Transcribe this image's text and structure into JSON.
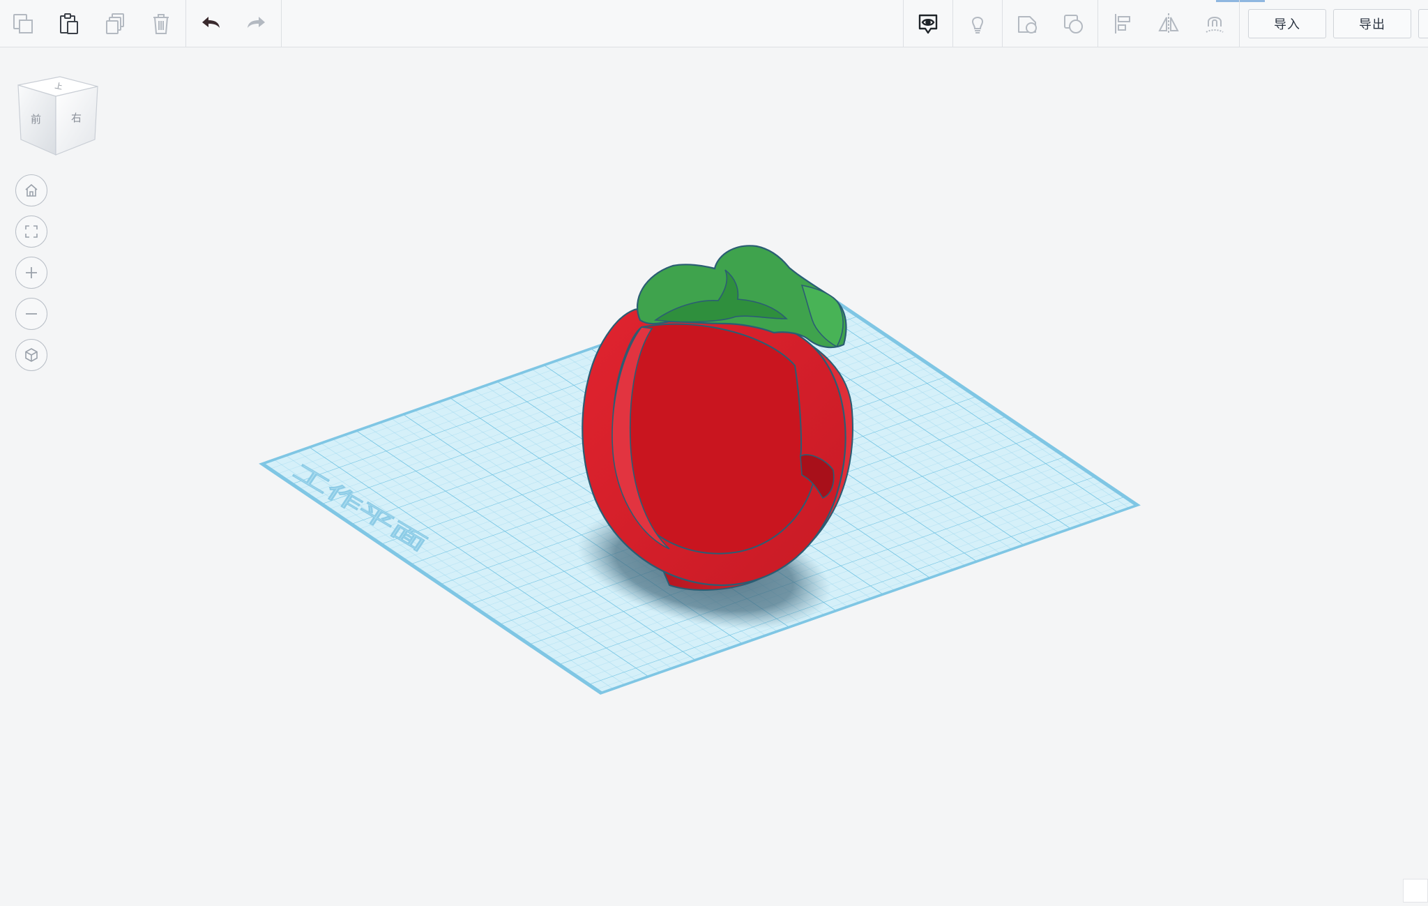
{
  "toolbar": {
    "left_tools": [
      {
        "name": "copy-icon",
        "enabled": false
      },
      {
        "name": "paste-icon",
        "enabled": true
      },
      {
        "name": "duplicate-icon",
        "enabled": false
      },
      {
        "name": "delete-icon",
        "enabled": false
      },
      {
        "name": "undo-icon",
        "enabled": true
      },
      {
        "name": "redo-icon",
        "enabled": false
      }
    ],
    "right_tools": [
      {
        "name": "show-all-icon",
        "enabled": true
      },
      {
        "name": "lightbulb-icon",
        "enabled": false
      },
      {
        "name": "solid-shape-icon",
        "enabled": false
      },
      {
        "name": "hole-shape-icon",
        "enabled": false
      },
      {
        "name": "align-icon",
        "enabled": false
      },
      {
        "name": "mirror-icon",
        "enabled": false
      },
      {
        "name": "group-magnet-icon",
        "enabled": false
      }
    ],
    "import_label": "导入",
    "export_label": "导出"
  },
  "viewcube": {
    "top_label": "上",
    "front_label": "前",
    "right_label": "右"
  },
  "view_controls": [
    {
      "name": "home-view-icon"
    },
    {
      "name": "fit-view-icon"
    },
    {
      "name": "zoom-in-icon"
    },
    {
      "name": "zoom-out-icon"
    },
    {
      "name": "perspective-icon"
    }
  ],
  "workplane": {
    "label": "工作平面",
    "grid_color": "#8fd0ea",
    "plane_color": "#cdeef8"
  },
  "model": {
    "body_color": "#d81e2a",
    "leaf_color": "#3fa34d",
    "outline_color": "#2b5d73"
  },
  "colors": {
    "toolbar_bg": "#f7f8f9",
    "canvas_bg": "#f4f5f6",
    "icon_active": "#3a3f47",
    "icon_disabled": "#b3b9c1"
  }
}
